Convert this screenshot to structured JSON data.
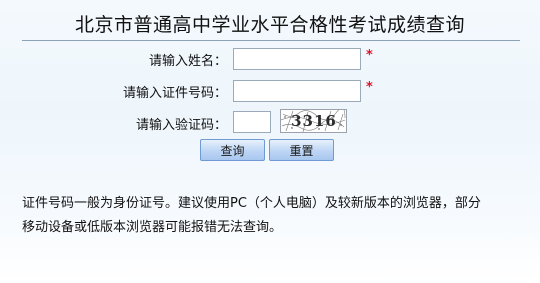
{
  "page": {
    "title": "北京市普通高中学业水平合格性考试成绩查询"
  },
  "form": {
    "name_label": "请输入姓名：",
    "name_value": "",
    "id_label": "请输入证件号码：",
    "id_value": "",
    "captcha_label": "请输入验证码：",
    "captcha_value": "",
    "captcha_text": "3316",
    "required_mark": "*"
  },
  "buttons": {
    "query": "查询",
    "reset": "重置"
  },
  "notice": {
    "line1": "证件号码一般为身份证号。建议使用PC（个人电脑）及较新版本的浏览器，部分",
    "line2": "移动设备或低版本浏览器可能报错无法查询。"
  },
  "colors": {
    "required": "#e0102a",
    "button_border": "#6f9ad3",
    "background": "#eef6fc"
  }
}
